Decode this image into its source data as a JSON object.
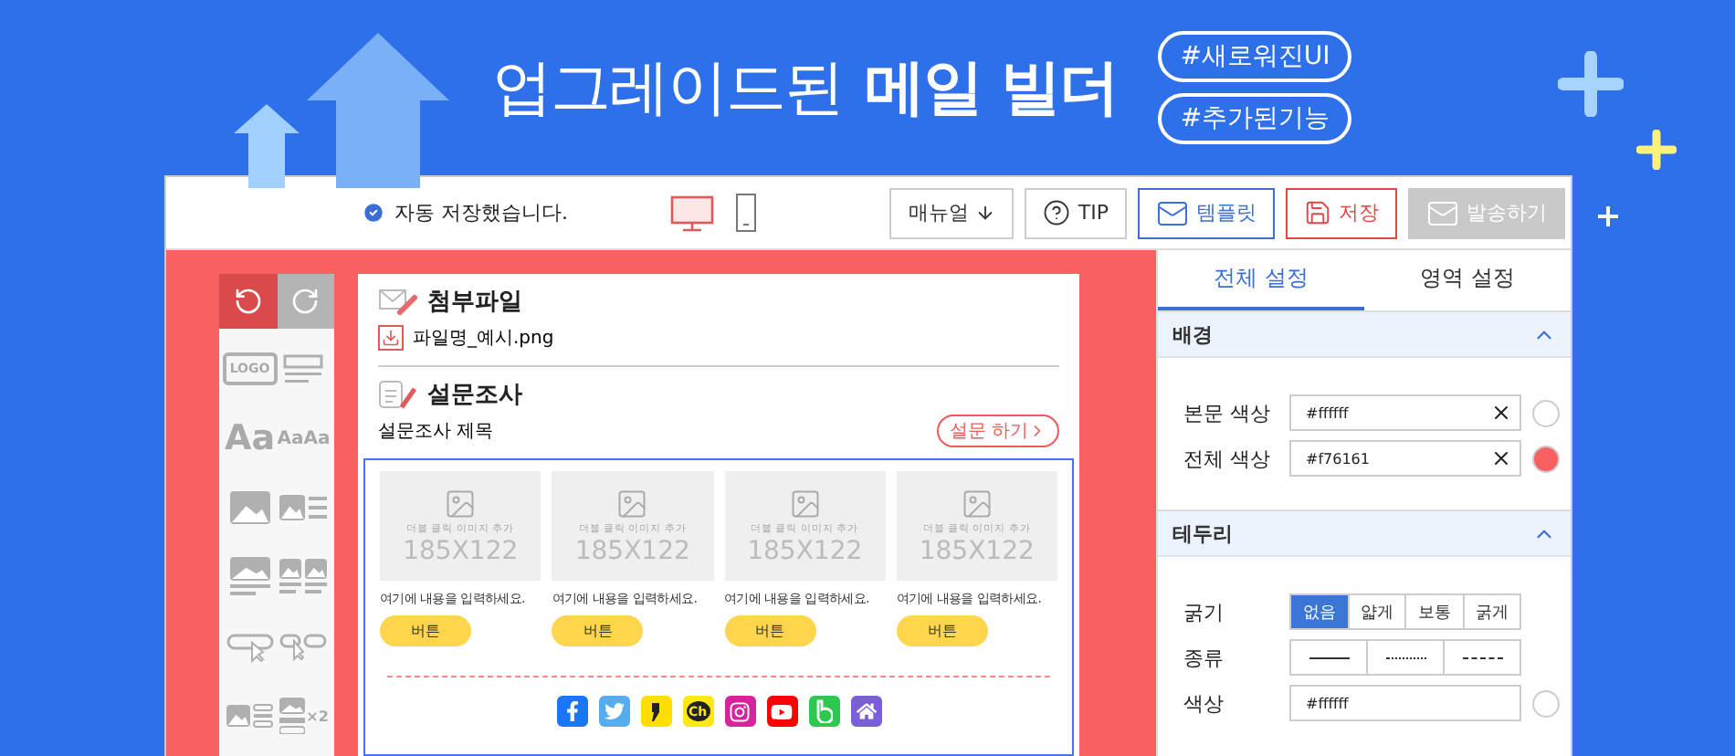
{
  "banner": {
    "title_light": "업그레이드된",
    "title_bold": "메일 빌더",
    "tags": [
      "#새로워진UI",
      "#추가된기능"
    ]
  },
  "toolbar": {
    "autosave": "자동 저장했습니다.",
    "devices": [
      {
        "kind": "desktop",
        "selected": true
      },
      {
        "kind": "mobile",
        "selected": false
      }
    ],
    "buttons": [
      {
        "kind": "manual",
        "label": "매뉴얼",
        "disabled": false
      },
      {
        "kind": "tip",
        "label": "TIP",
        "disabled": false
      },
      {
        "kind": "template",
        "label": "템플릿",
        "disabled": false
      },
      {
        "kind": "save",
        "label": "저장",
        "disabled": false
      },
      {
        "kind": "send",
        "label": "발송하기",
        "disabled": true
      }
    ]
  },
  "palette": {
    "history": [
      {
        "kind": "undo",
        "disabled": false
      },
      {
        "kind": "redo",
        "disabled": true
      }
    ],
    "tools": [
      {
        "kind": "logo",
        "label": "LOGO"
      },
      {
        "kind": "lines"
      },
      {
        "kind": "text-large",
        "label": "Aa"
      },
      {
        "kind": "text-small",
        "label": "AaAa"
      },
      {
        "kind": "image"
      },
      {
        "kind": "image-text"
      },
      {
        "kind": "image-caption"
      },
      {
        "kind": "image-pair"
      },
      {
        "kind": "button"
      },
      {
        "kind": "button-pair"
      },
      {
        "kind": "image-list"
      },
      {
        "kind": "image-multi",
        "label": "×2"
      }
    ]
  },
  "canvas": {
    "attachment": {
      "title": "첨부파일",
      "file": "파일명_예시.png"
    },
    "survey": {
      "title": "설문조사",
      "subtitle": "설문조사 제목",
      "button": "설문 하기"
    },
    "cards": [
      {
        "hint": "더블 클릭 이미지 추가",
        "size": "185X122",
        "text": "여기에 내용을 입력하세요.",
        "button": "버튼"
      },
      {
        "hint": "더블 클릭 이미지 추가",
        "size": "185X122",
        "text": "여기에 내용을 입력하세요.",
        "button": "버튼"
      },
      {
        "hint": "더블 클릭 이미지 추가",
        "size": "185X122",
        "text": "여기에 내용을 입력하세요.",
        "button": "버튼"
      },
      {
        "hint": "더블 클릭 이미지 추가",
        "size": "185X122",
        "text": "여기에 내용을 입력하세요.",
        "button": "버튼"
      }
    ],
    "social": [
      {
        "kind": "facebook",
        "color": "#1877f2"
      },
      {
        "kind": "twitter",
        "color": "#55acee"
      },
      {
        "kind": "kakaostory",
        "color": "#ffde00"
      },
      {
        "kind": "kakaochannel",
        "color": "#ffe812",
        "label": "Ch"
      },
      {
        "kind": "instagram",
        "color": "#d6249f"
      },
      {
        "kind": "youtube",
        "color": "#ff0000"
      },
      {
        "kind": "band",
        "color": "#2dc84d"
      },
      {
        "kind": "home",
        "color": "#7b5fd6"
      }
    ]
  },
  "panel": {
    "tabs": [
      {
        "label": "전체 설정",
        "selected": true
      },
      {
        "label": "영역 설정",
        "selected": false
      }
    ],
    "background": {
      "title": "배경",
      "expanded": true,
      "rows": [
        {
          "label": "본문 색상",
          "value": "#ffffff",
          "color": "#ffffff"
        },
        {
          "label": "전체 색상",
          "value": "#f76161",
          "color": "#f76161"
        }
      ]
    },
    "border": {
      "title": "테두리",
      "expanded": true,
      "thickness": {
        "label": "굵기",
        "options": [
          {
            "label": "없음",
            "selected": true
          },
          {
            "label": "얇게",
            "selected": false
          },
          {
            "label": "보통",
            "selected": false
          },
          {
            "label": "굵게",
            "selected": false
          }
        ]
      },
      "style": {
        "label": "종류",
        "options": [
          {
            "kind": "solid",
            "selected": false
          },
          {
            "kind": "dotted",
            "selected": false
          },
          {
            "kind": "dashed",
            "selected": false
          }
        ]
      },
      "color": {
        "label": "색상",
        "value": "#ffffff",
        "color": "#ffffff"
      }
    }
  }
}
